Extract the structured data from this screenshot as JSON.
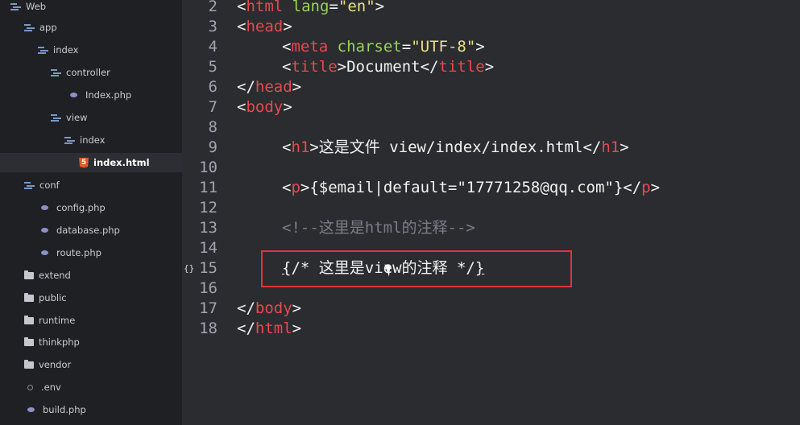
{
  "sidebar": {
    "items": [
      {
        "label": "Web",
        "icon": "folder-open-icon"
      },
      {
        "label": "app",
        "icon": "folder-open-icon"
      },
      {
        "label": "index",
        "icon": "folder-open-icon"
      },
      {
        "label": "controller",
        "icon": "folder-open-icon"
      },
      {
        "label": "Index.php",
        "icon": "php-file-icon"
      },
      {
        "label": "view",
        "icon": "folder-open-icon"
      },
      {
        "label": "index",
        "icon": "folder-open-icon"
      },
      {
        "label": "index.html",
        "icon": "html5-file-icon",
        "selected": true
      },
      {
        "label": "conf",
        "icon": "folder-open-icon"
      },
      {
        "label": "config.php",
        "icon": "php-file-icon"
      },
      {
        "label": "database.php",
        "icon": "php-file-icon"
      },
      {
        "label": "route.php",
        "icon": "php-file-icon"
      },
      {
        "label": "extend",
        "icon": "folder-icon"
      },
      {
        "label": "public",
        "icon": "folder-icon"
      },
      {
        "label": "runtime",
        "icon": "folder-icon"
      },
      {
        "label": "thinkphp",
        "icon": "folder-icon"
      },
      {
        "label": "vendor",
        "icon": "folder-icon"
      },
      {
        "label": ".env",
        "icon": "env-file-icon"
      },
      {
        "label": "build.php",
        "icon": "php-file-icon"
      }
    ]
  },
  "editor": {
    "lines": [
      {
        "n": "2",
        "parts": [
          [
            "txt",
            "<"
          ],
          [
            "tag",
            "html"
          ],
          [
            "txt",
            " "
          ],
          [
            "attr",
            "lang"
          ],
          [
            "txt",
            "="
          ],
          [
            "str",
            "\"en\""
          ],
          [
            "txt",
            ">"
          ]
        ]
      },
      {
        "n": "3",
        "parts": [
          [
            "txt",
            "<"
          ],
          [
            "tag",
            "head"
          ],
          [
            "txt",
            ">"
          ]
        ]
      },
      {
        "n": "4",
        "indent": true,
        "parts": [
          [
            "txt",
            "<"
          ],
          [
            "tag",
            "meta"
          ],
          [
            "txt",
            " "
          ],
          [
            "attr",
            "charset"
          ],
          [
            "txt",
            "="
          ],
          [
            "str",
            "\"UTF-8\""
          ],
          [
            "txt",
            ">"
          ]
        ]
      },
      {
        "n": "5",
        "indent": true,
        "parts": [
          [
            "txt",
            "<"
          ],
          [
            "tag",
            "title"
          ],
          [
            "txt",
            ">Document</"
          ],
          [
            "tag",
            "title"
          ],
          [
            "txt",
            ">"
          ]
        ]
      },
      {
        "n": "6",
        "parts": [
          [
            "txt",
            "</"
          ],
          [
            "tag",
            "head"
          ],
          [
            "txt",
            ">"
          ]
        ]
      },
      {
        "n": "7",
        "parts": [
          [
            "txt",
            "<"
          ],
          [
            "tag",
            "body"
          ],
          [
            "txt",
            ">"
          ]
        ]
      },
      {
        "n": "8",
        "parts": []
      },
      {
        "n": "9",
        "indent": true,
        "parts": [
          [
            "txt",
            "<"
          ],
          [
            "tag",
            "h1"
          ],
          [
            "txt",
            ">这是文件 view/index/index.html</"
          ],
          [
            "tag",
            "h1"
          ],
          [
            "txt",
            ">"
          ]
        ]
      },
      {
        "n": "10",
        "parts": []
      },
      {
        "n": "11",
        "indent": true,
        "parts": [
          [
            "txt",
            "<"
          ],
          [
            "tag",
            "p"
          ],
          [
            "txt",
            ">{$email|default=\"17771258@qq.com\"}</"
          ],
          [
            "tag",
            "p"
          ],
          [
            "txt",
            ">"
          ]
        ]
      },
      {
        "n": "12",
        "parts": []
      },
      {
        "n": "13",
        "indent": true,
        "parts": [
          [
            "cmt",
            "<!--这里是html的注释-->"
          ]
        ]
      },
      {
        "n": "14",
        "parts": []
      },
      {
        "n": "15",
        "indent": true,
        "gutter": "{}",
        "parts": [
          [
            "underline",
            "{"
          ],
          [
            "txt",
            "/* 这里是view的注释 */"
          ],
          [
            "underline",
            "}"
          ]
        ]
      },
      {
        "n": "16",
        "parts": []
      },
      {
        "n": "17",
        "parts": [
          [
            "txt",
            "</"
          ],
          [
            "tag",
            "body"
          ],
          [
            "txt",
            ">"
          ]
        ]
      },
      {
        "n": "18",
        "parts": [
          [
            "txt",
            "</"
          ],
          [
            "tag",
            "html"
          ],
          [
            "txt",
            ">"
          ]
        ]
      }
    ]
  },
  "colors": {
    "tag": "#e8494d",
    "attr": "#9bd35c",
    "string": "#ece07b",
    "comment": "#7b7d82",
    "highlight": "#d9373c"
  }
}
